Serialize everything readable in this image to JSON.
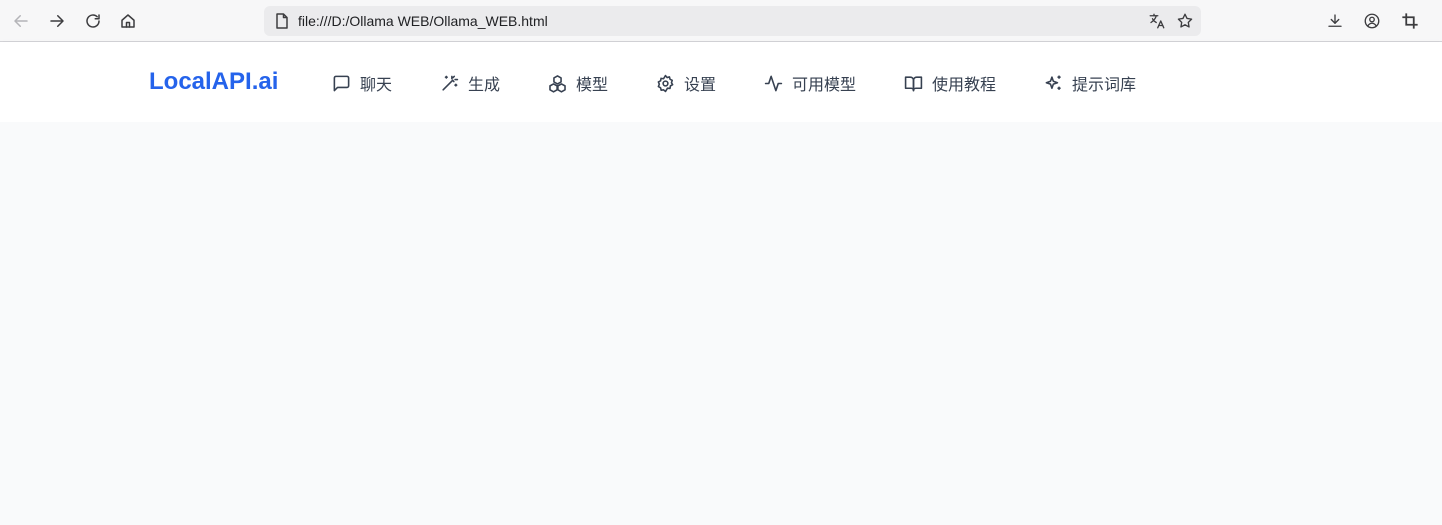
{
  "browser": {
    "url": "file:///D:/Ollama WEB/Ollama_WEB.html",
    "icons": {
      "back": "arrow-left-icon",
      "forward": "arrow-right-icon",
      "reload": "reload-icon",
      "home": "home-icon",
      "page": "page-icon",
      "translate": "translate-icon",
      "bookmark": "star-icon",
      "download": "download-icon",
      "profile": "profile-icon",
      "crop": "crop-icon"
    }
  },
  "app": {
    "brand": "LocalAPI.ai",
    "brand_color": "#2563eb",
    "nav": [
      {
        "label": "聊天",
        "icon": "message-square-icon"
      },
      {
        "label": "生成",
        "icon": "wand-icon"
      },
      {
        "label": "模型",
        "icon": "boxes-icon"
      },
      {
        "label": "设置",
        "icon": "settings-icon"
      },
      {
        "label": "可用模型",
        "icon": "activity-icon"
      },
      {
        "label": "使用教程",
        "icon": "book-open-icon"
      },
      {
        "label": "提示词库",
        "icon": "sparkles-icon"
      }
    ]
  }
}
